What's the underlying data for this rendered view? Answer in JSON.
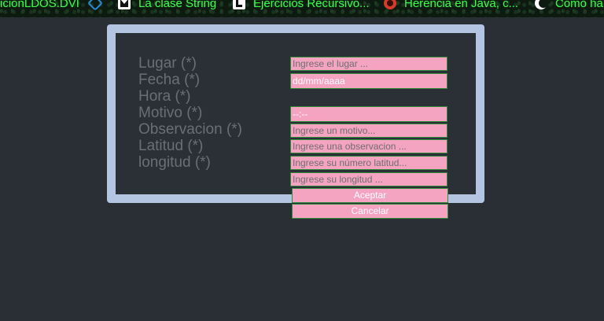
{
  "bookmarks": [
    {
      "label": "icionLDOS.DVI",
      "icon": "none"
    },
    {
      "label": "",
      "icon": "vscode-icon"
    },
    {
      "label": "La clase String",
      "icon": "m-icon"
    },
    {
      "label": "Ejercicios Recursivo...",
      "icon": "l-icon"
    },
    {
      "label": "Herencia en Java, c...",
      "icon": "red-logo-icon"
    },
    {
      "label": "Como ha",
      "icon": "moon-icon"
    }
  ],
  "form": {
    "labels": {
      "lugar": "Lugar (*)",
      "fecha": "Fecha (*)",
      "hora": "Hora (*)",
      "motivo": "Motivo (*)",
      "observacion": "Observacion (*)",
      "latitud": "Latitud (*)",
      "longitud": "longitud (*)"
    },
    "fields": {
      "lugar": "Ingrese el lugar ...",
      "fecha": "dd/mm/aaaa",
      "hora": "--:--",
      "motivo": "Ingrese un motivo...",
      "observacion": "Ingrese una observacion ...",
      "latitud": "Ingrese su número latitud...",
      "longitud": "Ingrese su longitud ..."
    },
    "buttons": {
      "accept": "Aceptar",
      "cancel": "Cancelar"
    }
  },
  "colors": {
    "background": "#2a2f35",
    "frame": "#b4c5e1",
    "field": "#f4a3c1",
    "field_border": "#2f8a3a",
    "bookmark_text": "#3cff4a"
  }
}
